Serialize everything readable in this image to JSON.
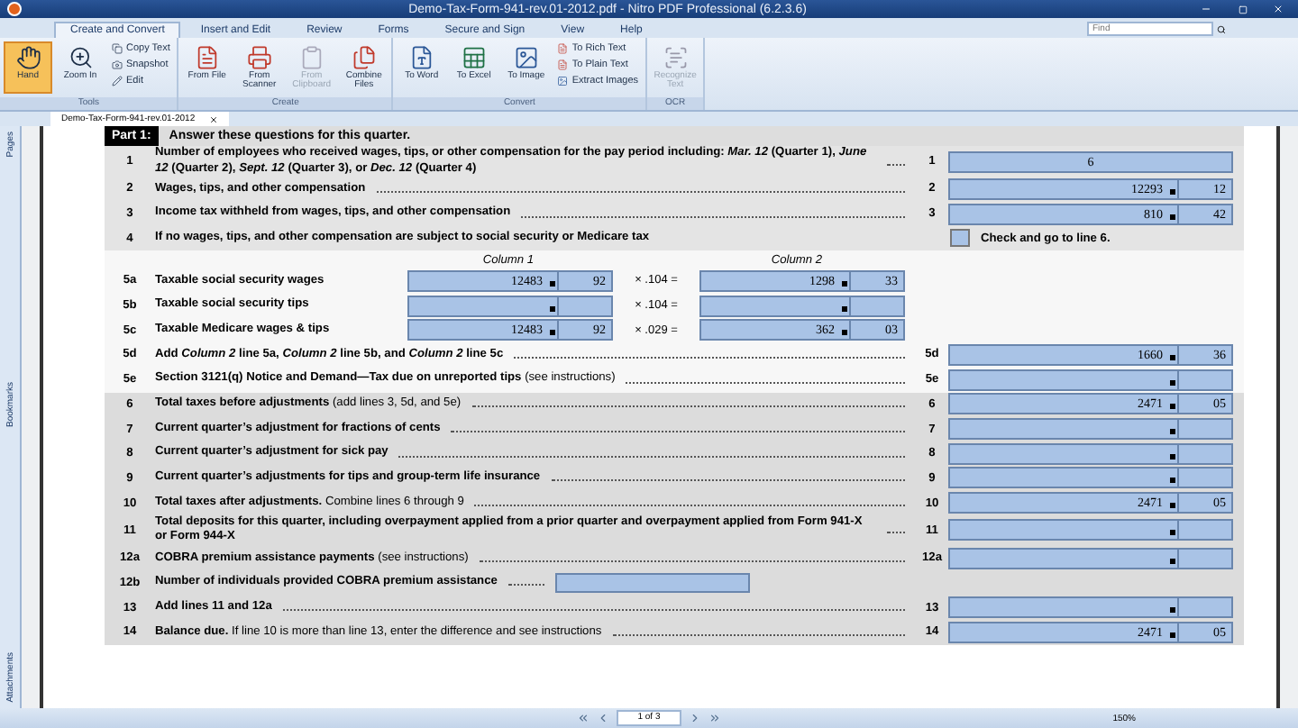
{
  "window": {
    "title": "Demo-Tax-Form-941-rev.01-2012.pdf - Nitro PDF Professional (6.2.3.6)"
  },
  "ribbon_tabs": [
    {
      "label": "Create and Convert",
      "selected": true
    },
    {
      "label": "Insert and Edit",
      "selected": false
    },
    {
      "label": "Review",
      "selected": false
    },
    {
      "label": "Forms",
      "selected": false
    },
    {
      "label": "Secure and Sign",
      "selected": false
    },
    {
      "label": "View",
      "selected": false
    },
    {
      "label": "Help",
      "selected": false
    }
  ],
  "find": {
    "placeholder": "Find"
  },
  "ribbon_groups": [
    {
      "label": "Tools",
      "large": [
        {
          "label": "Hand",
          "selected": true,
          "disabled": false
        },
        {
          "label": "Zoom In",
          "selected": false,
          "disabled": false
        }
      ],
      "small": [
        {
          "label": "Copy Text"
        },
        {
          "label": "Snapshot"
        },
        {
          "label": "Edit"
        }
      ]
    },
    {
      "label": "Create",
      "large": [
        {
          "label": "From File",
          "selected": false,
          "disabled": false
        },
        {
          "label": "From Scanner",
          "selected": false,
          "disabled": false
        },
        {
          "label": "From Clipboard",
          "selected": false,
          "disabled": true
        },
        {
          "label": "Combine Files",
          "selected": false,
          "disabled": false
        }
      ]
    },
    {
      "label": "Convert",
      "large": [
        {
          "label": "To Word",
          "selected": false,
          "disabled": false
        },
        {
          "label": "To Excel",
          "selected": false,
          "disabled": false
        },
        {
          "label": "To Image",
          "selected": false,
          "disabled": false
        }
      ],
      "small": [
        {
          "label": "To Rich Text"
        },
        {
          "label": "To Plain Text"
        },
        {
          "label": "Extract Images"
        }
      ]
    },
    {
      "label": "OCR",
      "large": [
        {
          "label": "Recognize Text",
          "selected": false,
          "disabled": true
        }
      ]
    }
  ],
  "document_tab": {
    "label": "Demo-Tax-Form-941-rev.01-2012"
  },
  "side_tabs": [
    {
      "label": "Pages"
    },
    {
      "label": "Bookmarks"
    },
    {
      "label": "Attachments"
    }
  ],
  "part": {
    "label": "Part 1:",
    "title": "Answer these questions for this quarter."
  },
  "column_headers": [
    "Column 1",
    "Column 2"
  ],
  "rows": [
    {
      "kind": "amount",
      "number": "1",
      "label": "Number of employees who received wages, tips, or other compensation for the pay period including: *Mar. 12* (Quarter 1), *June 12* (Quarter 2), *Sept. 12* (Quarter 3), or *Dec. 12* (Quarter 4)",
      "line": "1",
      "whole": "6"
    },
    {
      "kind": "amount",
      "number": "2",
      "label": "Wages, tips, and other compensation",
      "line": "2",
      "dollars": "12293",
      "cents": "12"
    },
    {
      "kind": "amount",
      "number": "3",
      "label": "Income tax withheld from wages, tips, and other compensation",
      "line": "3",
      "dollars": "810",
      "cents": "42"
    },
    {
      "kind": "checkbox",
      "number": "4",
      "label": "If no wages, tips, and other compensation are subject to social security or Medicare tax",
      "checked": false,
      "check_label": "Check and go to line 6."
    },
    {
      "kind": "columns",
      "number": "5a",
      "label": "Taxable social security wages",
      "col1_dollars": "12483",
      "col1_cents": "92",
      "rate": "× .104 =",
      "col2_dollars": "1298",
      "col2_cents": "33"
    },
    {
      "kind": "columns",
      "number": "5b",
      "label": "Taxable social security tips",
      "rate": "× .104 ="
    },
    {
      "kind": "columns",
      "number": "5c",
      "label": "Taxable Medicare wages & tips",
      "col1_dollars": "12483",
      "col1_cents": "92",
      "rate": "× .029 =",
      "col2_dollars": "362",
      "col2_cents": "03"
    },
    {
      "kind": "amount",
      "number": "5d",
      "label": "Add *Column 2* line 5a, *Column 2* line 5b, and *Column 2* line 5c",
      "line": "5d",
      "dollars": "1660",
      "cents": "36"
    },
    {
      "kind": "amount",
      "number": "5e",
      "label": "Section 3121(q) Notice and Demand—Tax due on unreported tips",
      "note": "(see instructions)",
      "line": "5e"
    },
    {
      "kind": "amount",
      "number": "6",
      "label": "Total taxes before adjustments",
      "note": "(add lines 3, 5d, and 5e)",
      "line": "6",
      "dollars": "2471",
      "cents": "05"
    },
    {
      "kind": "amount",
      "number": "7",
      "label": "Current quarter’s adjustment for fractions of cents",
      "line": "7"
    },
    {
      "kind": "amount",
      "number": "8",
      "label": "Current quarter’s adjustment for sick pay",
      "line": "8"
    },
    {
      "kind": "amount",
      "number": "9",
      "label": "Current quarter’s adjustments for tips and group-term life insurance",
      "line": "9"
    },
    {
      "kind": "amount",
      "number": "10",
      "label": "Total taxes after adjustments.",
      "note": "Combine lines 6 through 9",
      "line": "10",
      "dollars": "2471",
      "cents": "05"
    },
    {
      "kind": "amount",
      "number": "11",
      "label": "Total deposits for this quarter, including overpayment applied from a prior quarter and overpayment applied from Form 941-X or Form 944-X",
      "line": "11"
    },
    {
      "kind": "amount",
      "number": "12a",
      "label": "COBRA premium assistance payments",
      "note": "(see instructions)",
      "line": "12a"
    },
    {
      "kind": "count",
      "number": "12b",
      "label": "Number of individuals provided COBRA premium assistance"
    },
    {
      "kind": "amount",
      "number": "13",
      "label": "Add lines 11 and 12a",
      "line": "13"
    },
    {
      "kind": "amount",
      "number": "14",
      "label": "Balance due.",
      "note": "If line 10 is more than line 13, enter the difference and see instructions",
      "line": "14",
      "dollars": "2471",
      "cents": "05"
    }
  ],
  "status_bar": {
    "page": "1 of 3",
    "zoom": "150%"
  }
}
